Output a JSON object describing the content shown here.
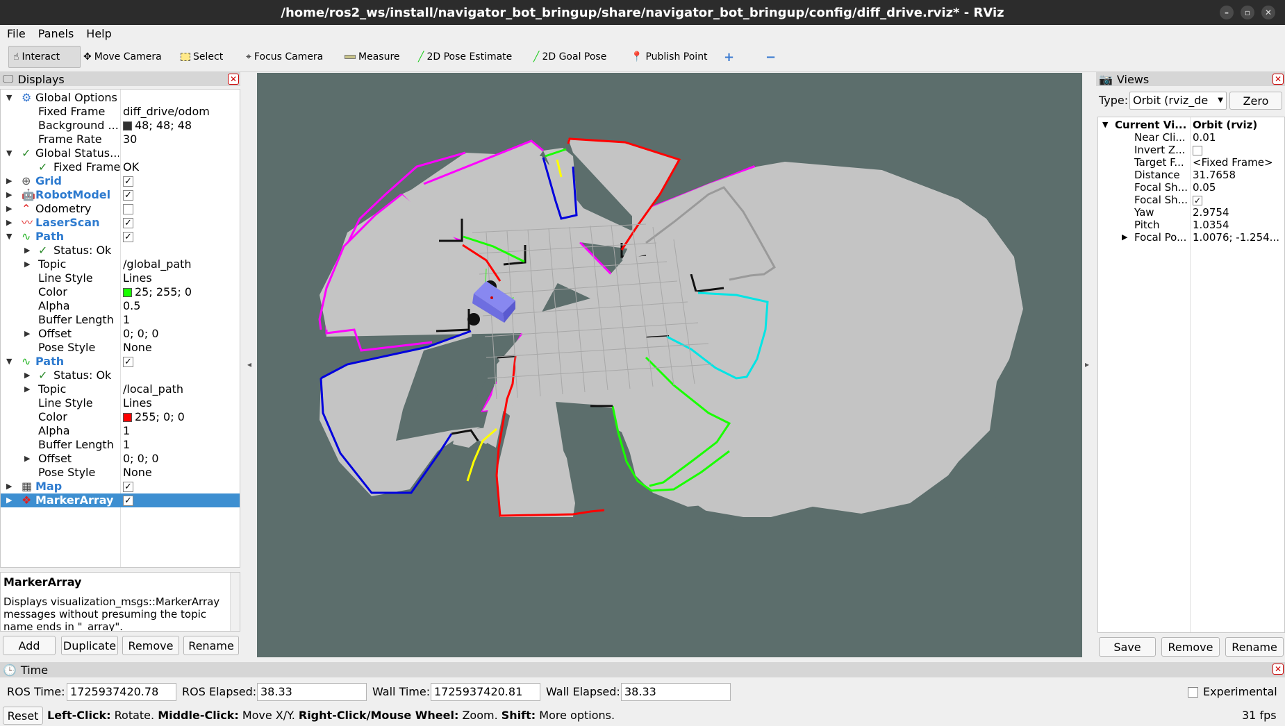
{
  "window": {
    "title": "/home/ros2_ws/install/navigator_bot_bringup/share/navigator_bot_bringup/config/diff_drive.rviz* - RViz"
  },
  "menu": [
    "File",
    "Panels",
    "Help"
  ],
  "toolbar": {
    "interact": "Interact",
    "move_camera": "Move Camera",
    "select": "Select",
    "focus_camera": "Focus Camera",
    "measure": "Measure",
    "pose_estimate": "2D Pose Estimate",
    "goal_pose": "2D Goal Pose",
    "publish_point": "Publish Point"
  },
  "displays": {
    "title": "Displays",
    "rows": {
      "global_options": "Global Options",
      "fixed_frame_k": "Fixed Frame",
      "fixed_frame_v": "diff_drive/odom",
      "background_k": "Background ...",
      "background_v": "48; 48; 48",
      "frame_rate_k": "Frame Rate",
      "frame_rate_v": "30",
      "global_status": "Global Status...",
      "gs_fixed_frame_k": "Fixed Frame",
      "gs_fixed_frame_v": "OK",
      "grid": "Grid",
      "robot_model": "RobotModel",
      "odometry": "Odometry",
      "laser_scan": "LaserScan",
      "path1": "Path",
      "p1_status": "Status: Ok",
      "p1_topic_k": "Topic",
      "p1_topic_v": "/global_path",
      "p1_style_k": "Line Style",
      "p1_style_v": "Lines",
      "p1_color_k": "Color",
      "p1_color_v": "25; 255; 0",
      "p1_alpha_k": "Alpha",
      "p1_alpha_v": "0.5",
      "p1_buf_k": "Buffer Length",
      "p1_buf_v": "1",
      "p1_offset_k": "Offset",
      "p1_offset_v": "0; 0; 0",
      "p1_pose_k": "Pose Style",
      "p1_pose_v": "None",
      "path2": "Path",
      "p2_status": "Status: Ok",
      "p2_topic_k": "Topic",
      "p2_topic_v": "/local_path",
      "p2_style_k": "Line Style",
      "p2_style_v": "Lines",
      "p2_color_k": "Color",
      "p2_color_v": "255; 0; 0",
      "p2_alpha_k": "Alpha",
      "p2_alpha_v": "1",
      "p2_buf_k": "Buffer Length",
      "p2_buf_v": "1",
      "p2_offset_k": "Offset",
      "p2_offset_v": "0; 0; 0",
      "p2_pose_k": "Pose Style",
      "p2_pose_v": "None",
      "map": "Map",
      "marker_array": "MarkerArray"
    },
    "desc_title": "MarkerArray",
    "desc_text": "Displays visualization_msgs::MarkerArray messages without presuming the topic name ends in \"_array\".",
    "buttons": {
      "add": "Add",
      "duplicate": "Duplicate",
      "remove": "Remove",
      "rename": "Rename"
    }
  },
  "views": {
    "title": "Views",
    "type_label": "Type:",
    "type_value": "Orbit (rviz_de",
    "zero": "Zero",
    "current_k": "Current Vi...",
    "current_v": "Orbit (rviz)",
    "near_k": "Near Cli...",
    "near_v": "0.01",
    "invert_k": "Invert Z...",
    "target_k": "Target F...",
    "target_v": "<Fixed Frame>",
    "distance_k": "Distance",
    "distance_v": "31.7658",
    "focal1_k": "Focal Sh...",
    "focal1_v": "0.05",
    "focal2_k": "Focal Sh...",
    "yaw_k": "Yaw",
    "yaw_v": "2.9754",
    "pitch_k": "Pitch",
    "pitch_v": "1.0354",
    "focalpo_k": "Focal Po...",
    "focalpo_v": "1.0076; -1.254...",
    "buttons": {
      "save": "Save",
      "remove": "Remove",
      "rename": "Rename"
    }
  },
  "time": {
    "title": "Time",
    "ros_time_label": "ROS Time:",
    "ros_time": "1725937420.78",
    "ros_elapsed_label": "ROS Elapsed:",
    "ros_elapsed": "38.33",
    "wall_time_label": "Wall Time:",
    "wall_time": "1725937420.81",
    "wall_elapsed_label": "Wall Elapsed:",
    "wall_elapsed": "38.33",
    "experimental": "Experimental",
    "reset": "Reset",
    "hint_1b": "Left-Click:",
    "hint_1": "Rotate.",
    "hint_2b": "Middle-Click:",
    "hint_2": "Move X/Y.",
    "hint_3b": "Right-Click/Mouse Wheel:",
    "hint_3": "Zoom.",
    "hint_4b": "Shift:",
    "hint_4": "More options.",
    "fps": "31 fps"
  },
  "colors": {
    "viewport_bg": "#5c6e6c",
    "map_free": "#c4c4c4",
    "selection": "#3d8fd1",
    "path_global": "#19ff00",
    "path_local": "#ff0000",
    "robot": "#8080f0"
  }
}
